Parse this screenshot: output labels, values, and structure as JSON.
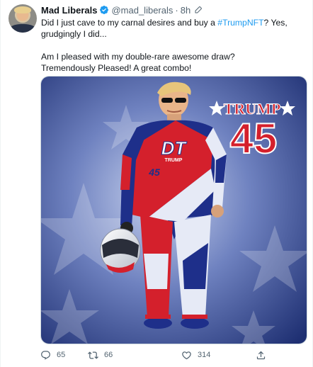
{
  "author": {
    "name": "Mad Liberals",
    "handle": "@mad_liberals",
    "separator": "·",
    "time": "8h"
  },
  "tweet": {
    "line1_before": "Did I just cave to my carnal desires and buy a ",
    "hashtag": "#TrumpNFT",
    "line1_after": "?  Yes, grudgingly I did...",
    "line2": "Am I pleased with my double-rare awesome draw?",
    "line3": "Tremendously Pleased! A great combo!"
  },
  "media": {
    "title_word": "TRUMP",
    "number": "45",
    "chest_logo": "DT",
    "chest_sub": "TRUMP",
    "leg_number": "45"
  },
  "actions": {
    "replies": "65",
    "retweets": "66",
    "likes": "314"
  },
  "colors": {
    "link": "#1d9bf0",
    "muted": "#536471",
    "verified": "#1d9bf0",
    "card_red": "#d4202c",
    "card_blue": "#1e2f8a"
  },
  "icons": [
    "verified-badge-icon",
    "edit-icon",
    "reply-icon",
    "retweet-icon",
    "like-icon",
    "share-icon"
  ]
}
